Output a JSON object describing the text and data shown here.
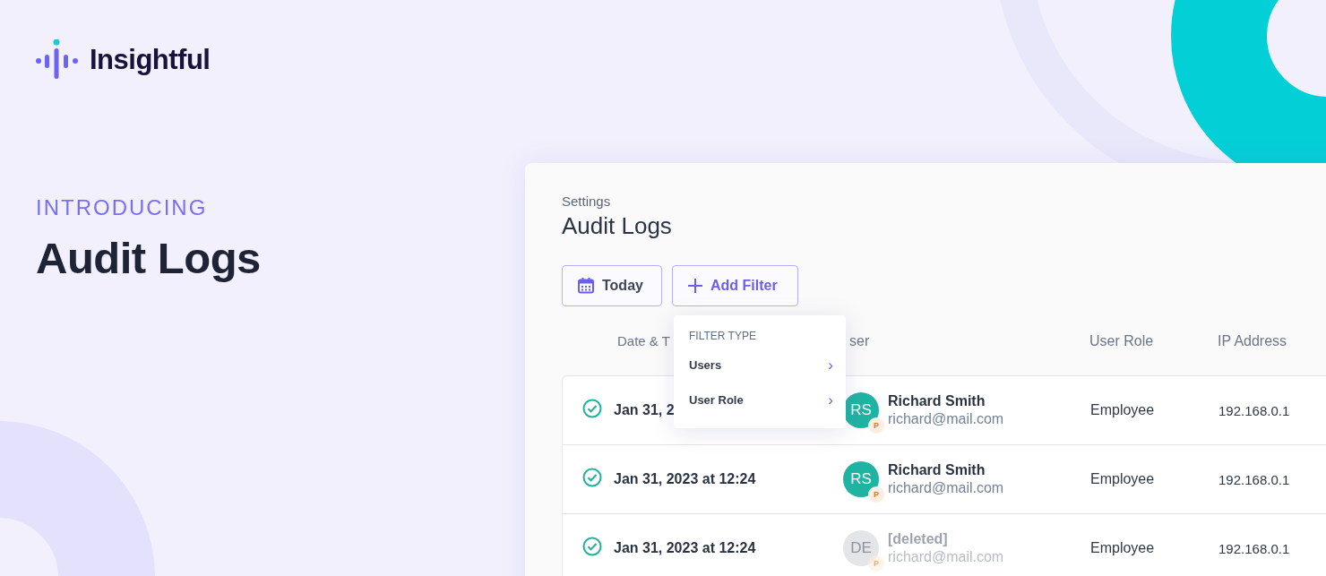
{
  "brand": {
    "name": "Insightful"
  },
  "hero": {
    "eyebrow": "INTRODUCING",
    "title": "Audit Logs"
  },
  "app": {
    "breadcrumb": "Settings",
    "title": "Audit Logs",
    "toolbar": [
      {
        "kind": "date",
        "label": "Today"
      },
      {
        "kind": "add",
        "label": "Add Filter"
      }
    ],
    "filter_menu": {
      "heading": "FILTER TYPE",
      "items": [
        {
          "label": "Users",
          "arrow": "›"
        },
        {
          "label": "User Role",
          "arrow": "›"
        }
      ]
    },
    "table": {
      "columns": [
        "Date & T",
        "ser",
        "User Role",
        "IP Address"
      ],
      "rows": [
        {
          "date": "Jan 31, 2",
          "initials": "RS",
          "color": "#1fb3a2",
          "badge": "P",
          "name": "Richard Smith",
          "email": "richard@mail.com",
          "deleted": false,
          "role": "Employee",
          "ip": "192.168.0.1"
        },
        {
          "date": "Jan 31, 2023 at 12:24",
          "initials": "RS",
          "color": "#1fb3a2",
          "badge": "P",
          "name": "Richard Smith",
          "email": "richard@mail.com",
          "deleted": false,
          "role": "Employee",
          "ip": "192.168.0.1"
        },
        {
          "date": "Jan 31, 2023 at 12:24",
          "initials": "DE",
          "color": "#e4e5e8",
          "badge": "P",
          "name": "[deleted]",
          "email": "richard@mail.com",
          "deleted": true,
          "role": "Employee",
          "ip": "192.168.0.1"
        }
      ]
    }
  }
}
